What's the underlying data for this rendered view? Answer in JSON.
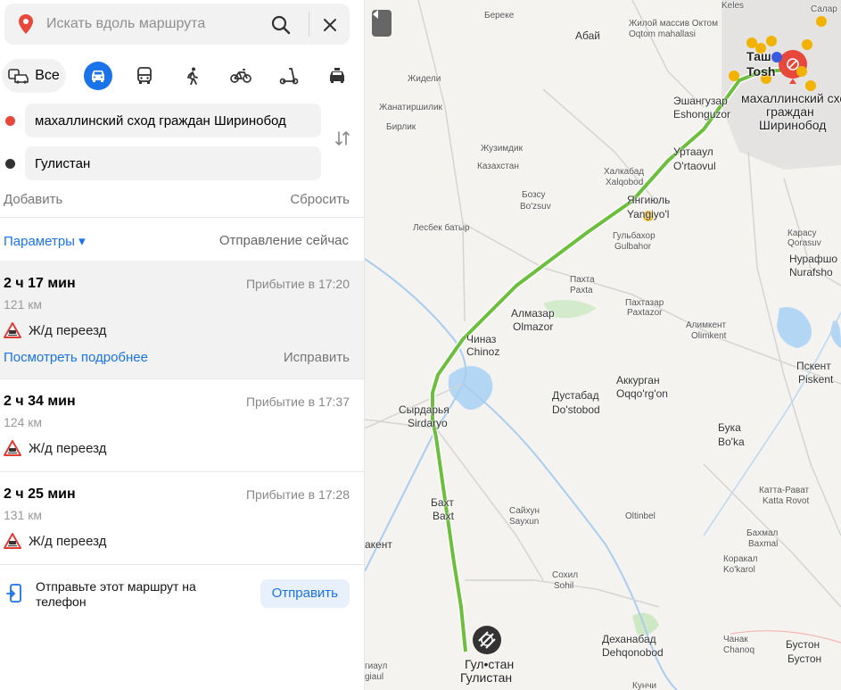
{
  "search": {
    "placeholder": "Искать вдоль маршрута"
  },
  "modes": {
    "all_label": "Все"
  },
  "route_points": {
    "from": "махаллинский сход граждан Ширинобод",
    "to": "Гулистан"
  },
  "actions": {
    "add": "Добавить",
    "reset": "Сбросить"
  },
  "params": {
    "label": "Параметры ▾",
    "departure": "Отправление сейчас"
  },
  "routes": [
    {
      "time": "2 ч 17 мин",
      "arrival": "Прибытие в 17:20",
      "distance": "121 км",
      "warning": "Ж/д переезд",
      "details": "Посмотреть подробнее",
      "fix": "Исправить"
    },
    {
      "time": "2 ч 34 мин",
      "arrival": "Прибытие в 17:37",
      "distance": "124 км",
      "warning": "Ж/д переезд"
    },
    {
      "time": "2 ч 25 мин",
      "arrival": "Прибытие в 17:28",
      "distance": "131 км",
      "warning": "Ж/д переезд"
    }
  ],
  "send": {
    "text": "Отправьте этот маршрут на телефон",
    "button": "Отправить"
  },
  "colors": {
    "accent": "#1a73e8",
    "route": "#6cbf3c",
    "start_pin": "#e8473b",
    "water": "#b3d6f5"
  },
  "map": {
    "labels": {
      "bereke": "Береке",
      "keles": "Keles",
      "salar": "Салар",
      "abay": "Абай",
      "oktom": "Жилой массив Октом",
      "oktom_uz": "Oqtom mahallasi",
      "zhideli": "Жидели",
      "zhanatirshi": "Жанатиршилик",
      "birlik": "Бирлик",
      "tash_a": "Таш",
      "tash_b": "Tosh",
      "eshanguzar": "Эшангузар",
      "eshanguzar_uz": "Eshonguzor",
      "dest_a": "махаллинский сход",
      "dest_b": "граждан",
      "dest_c": "Ширинобод",
      "zhuzimdik": "Жузимдик",
      "kazakhstan": "Казахстан",
      "urtaaul": "Уртааул",
      "urtaaul_uz": "O'rtaovul",
      "khalkabad": "Халкабад",
      "khalkabad_uz": "Xalqobod",
      "bozsu": "Бозсу",
      "bozsu_uz": "Bo'zsuv",
      "yangiyul": "Янгиюль",
      "yangiyul_uz": "Yangiyo'l",
      "lesbek": "Лесбек батыр",
      "gulbakhor": "Гульбахор",
      "gulbakhor_uz": "Gulbahor",
      "karasu": "Карасу",
      "karasu_uz": "Qorasuv",
      "nurafshon": "Нурафшо",
      "nurafshon_uz": "Nurafsho",
      "pakhta": "Пахта",
      "pakhta_uz": "Paxta",
      "pakhtazar": "Пахтазар",
      "pakhtazar_uz": "Paxtazor",
      "almazar": "Алмазар",
      "almazar_uz": "Olmazor",
      "alimkent": "Алимкент",
      "alimkent_uz": "Olimkent",
      "chinaz": "Чиназ",
      "chinaz_uz": "Chinoz",
      "pskent": "Пскент",
      "pskent_uz": "Piskent",
      "akkurgan": "Аккурган",
      "akkurgan_uz": "Oqqo'rg'on",
      "dustabad": "Дустабад",
      "dustabad_uz": "Do'stobod",
      "syrdarya": "Сырдарья",
      "syrdarya_uz": "Sirdaryo",
      "buka": "Бука",
      "buka_uz": "Bo'ka",
      "kattarabat": "Катта-Рават",
      "kattarabat_uz": "Katta Rovot",
      "bakht": "Бахт",
      "bakht_uz": "Baxt",
      "saikhun": "Сайхун",
      "saikhun_uz": "Sayxun",
      "oltinbel": "Oltinbel",
      "bakhmal": "Бахмал",
      "bakhmal_uz": "Baxmal",
      "kent": "акент",
      "sokhil": "Сохил",
      "sokhil_uz": "Sohil",
      "karakal": "Коракал",
      "karakal_uz": "Ko'karol",
      "dekhkanabad": "Деханабад",
      "dekhkanabad_uz": "Dehqonobod",
      "chanak": "Чанак",
      "chanak_uz": "Chanoq",
      "buston": "Бустон",
      "buston_uz": "Бустон",
      "giaul": "гиаул",
      "giaul_uz": "giaul",
      "gulistan_a": "Гул•стан",
      "gulistan_b": "Гулистан",
      "kunchi": "Кунчи"
    }
  }
}
